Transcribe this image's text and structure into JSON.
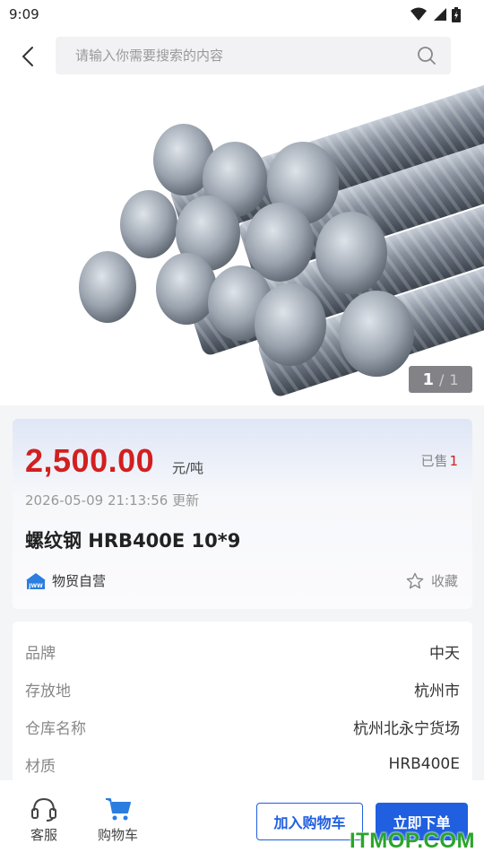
{
  "status_bar": {
    "time": "9:09"
  },
  "search": {
    "placeholder": "请输入你需要搜索的内容"
  },
  "gallery": {
    "current": "1",
    "separator": "/",
    "total": "1"
  },
  "product": {
    "price": "2,500.00",
    "unit": "元/吨",
    "sold_label": "已售",
    "sold_count": "1",
    "update_time": "2026-05-09 21:13:56 更新",
    "title": "螺纹钢 HRB400E 10*9",
    "store_name": "物贸自营",
    "store_logo_text": "JWW",
    "favorite_label": "收藏"
  },
  "specs": [
    {
      "label": "品牌",
      "value": "中天"
    },
    {
      "label": "存放地",
      "value": "杭州市"
    },
    {
      "label": "仓库名称",
      "value": "杭州北永宁货场"
    },
    {
      "label": "材质",
      "value": "HRB400E"
    }
  ],
  "bottom_bar": {
    "service_label": "客服",
    "cart_label": "购物车",
    "add_to_cart": "加入购物车",
    "buy_now": "立即下单"
  },
  "watermark": "ITMOP.COM",
  "colors": {
    "accent": "#1f5fe0",
    "price": "#d21f1f",
    "watermark": "#2aa52a"
  }
}
